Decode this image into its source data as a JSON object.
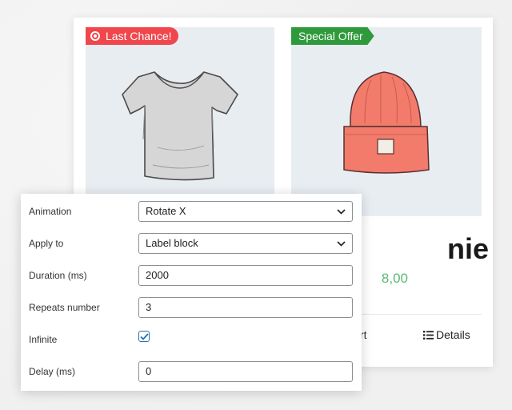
{
  "cards": {
    "left": {
      "badge": "Last Chance!"
    },
    "right": {
      "badge": "Special Offer",
      "name_fragment": "nie",
      "price_fragment": "8,00",
      "cart_fragment": "rt",
      "details_label": "Details"
    }
  },
  "settings": {
    "animation": {
      "label": "Animation",
      "value": "Rotate X"
    },
    "apply_to": {
      "label": "Apply to",
      "value": "Label block"
    },
    "duration": {
      "label": "Duration (ms)",
      "value": "2000"
    },
    "repeats": {
      "label": "Repeats number",
      "value": "3"
    },
    "infinite": {
      "label": "Infinite",
      "checked": true
    },
    "delay": {
      "label": "Delay (ms)",
      "value": "0"
    }
  },
  "colors": {
    "red_badge": "#f0474c",
    "green_badge": "#2f9a3c",
    "price": "#5bb874",
    "checkbox": "#2271b1"
  },
  "icons": [
    "fire-icon",
    "tshirt-image",
    "beanie-image",
    "list-icon",
    "chevron-down-icon",
    "checkmark-icon"
  ]
}
